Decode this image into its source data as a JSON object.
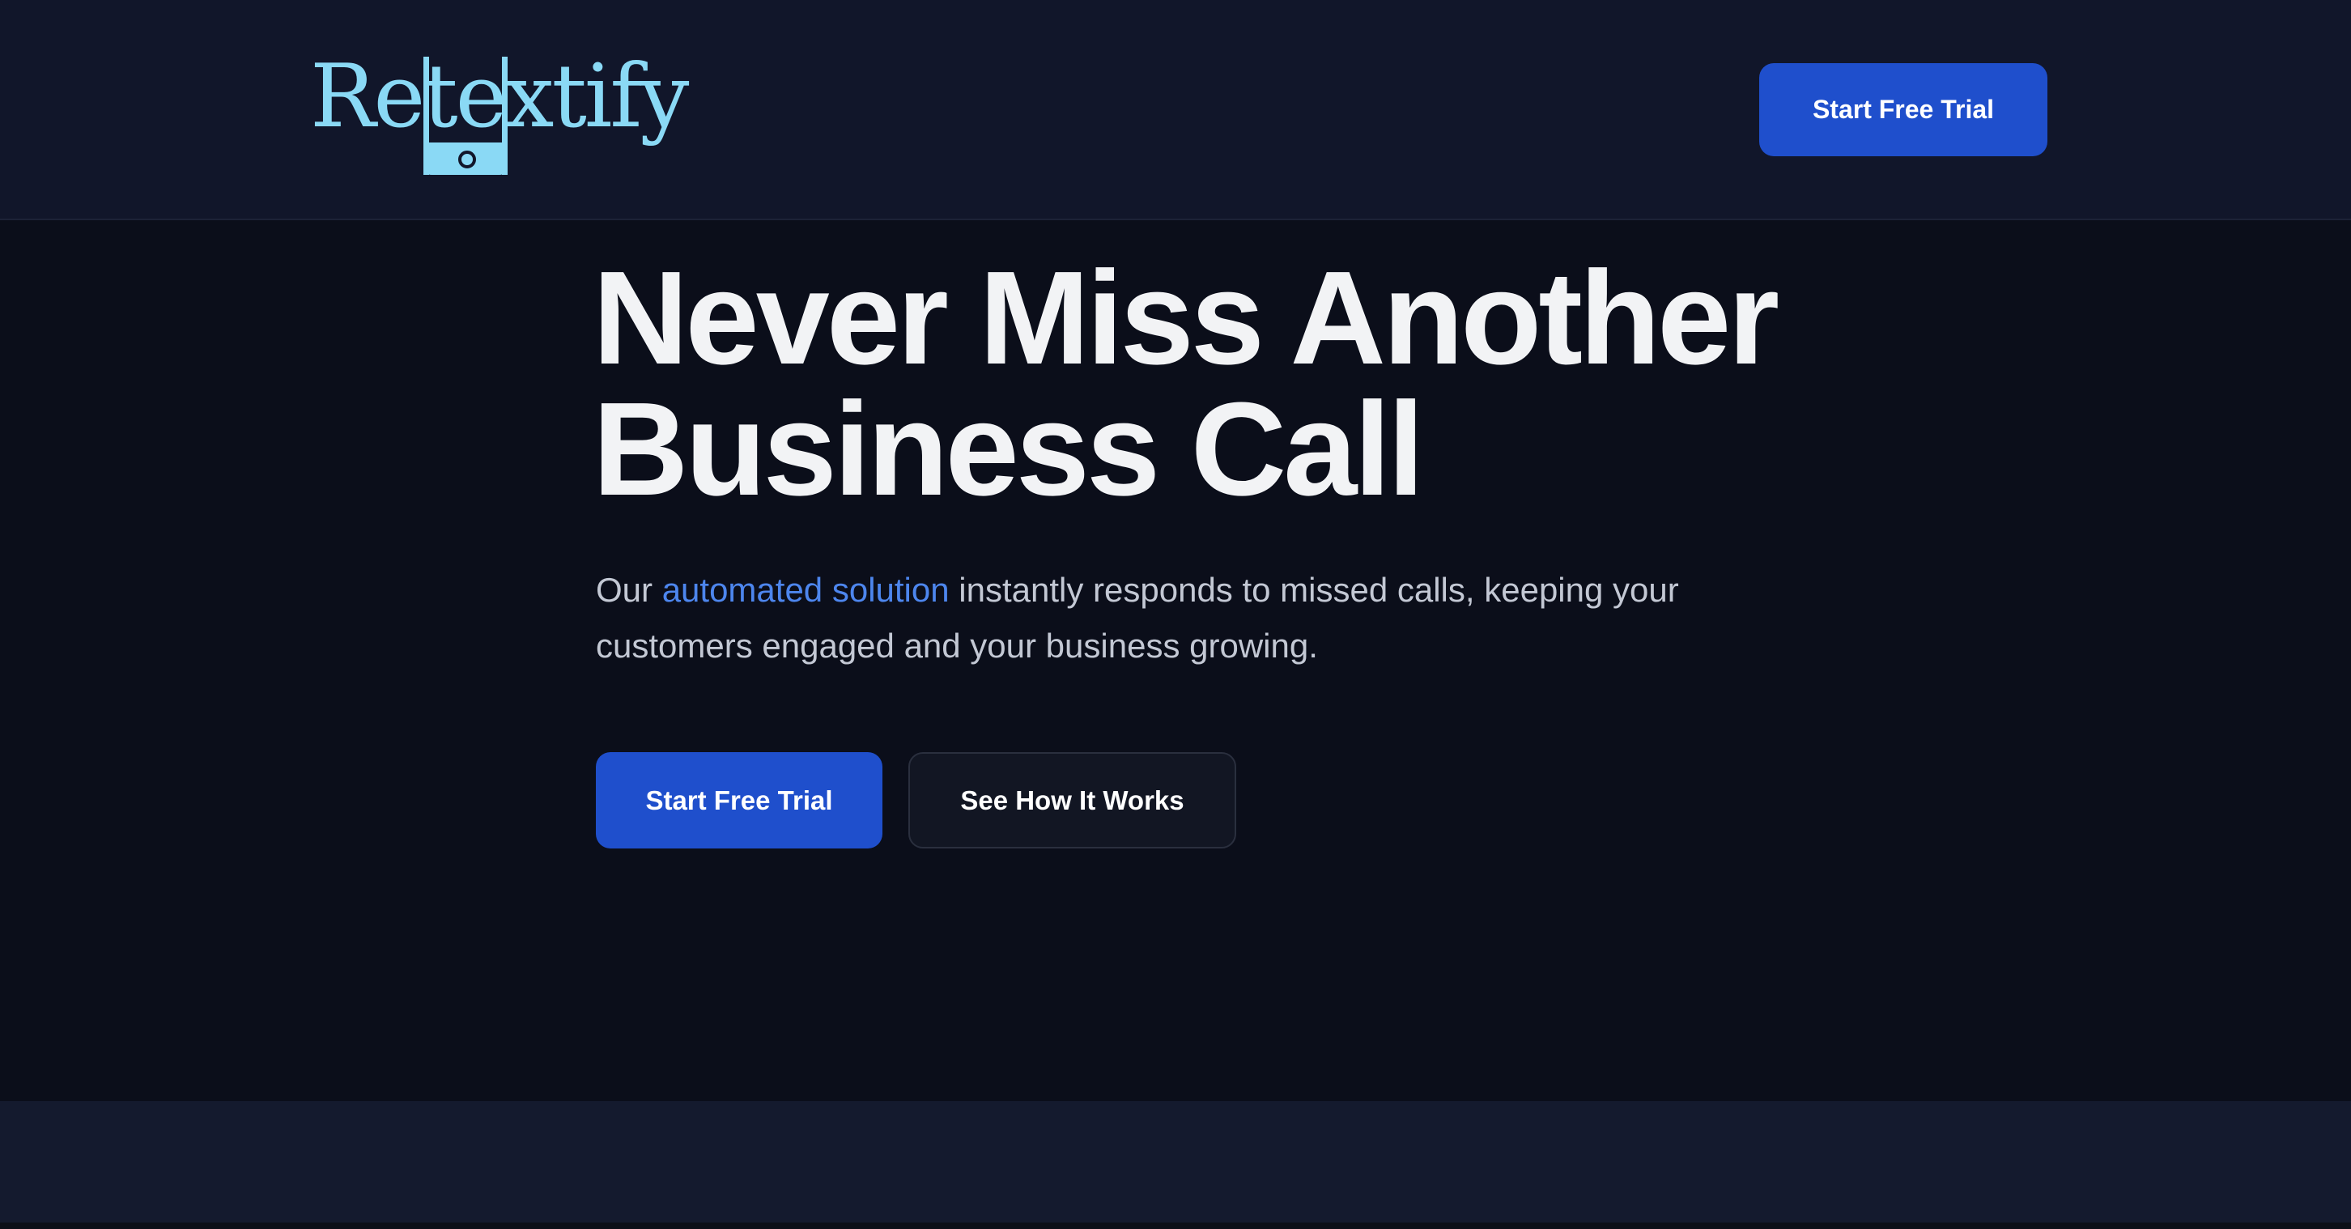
{
  "header": {
    "logo_text": "Retextify",
    "cta_label": "Start Free Trial"
  },
  "hero": {
    "title_line1": "Never Miss Another",
    "title_line2": "Business Call",
    "subtitle_prefix": "Our ",
    "subtitle_accent": "automated solution",
    "subtitle_rest": " instantly responds to missed calls, keeping your customers engaged and your business growing.",
    "primary_cta": "Start Free Trial",
    "secondary_cta": "See How It Works"
  },
  "colors": {
    "background": "#0b0e1a",
    "header_background": "#11162a",
    "accent_blue": "#1f4fcc",
    "link_blue": "#4d86ee",
    "logo_cyan": "#8ad9f5"
  }
}
